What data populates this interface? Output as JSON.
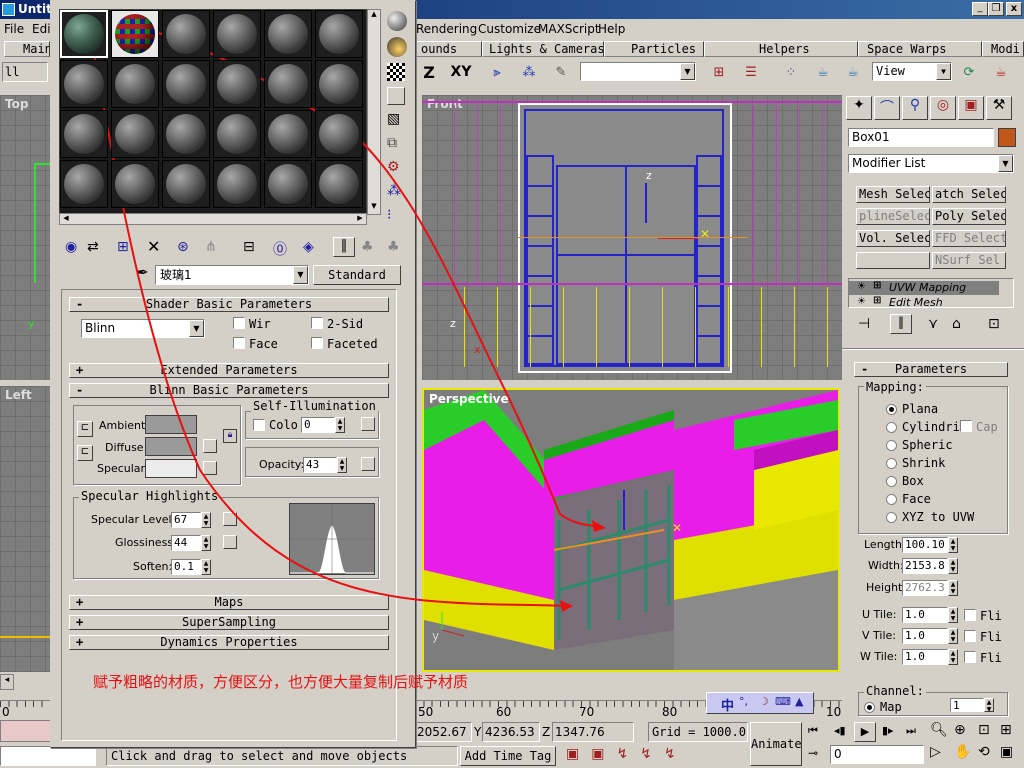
{
  "app": {
    "title": "Untit",
    "window_controls": {
      "minimize": "_",
      "restore": "❐",
      "close": "x"
    }
  },
  "menu": {
    "items": [
      "File",
      "Edit",
      "Rendering",
      "Customize",
      "MAXScript",
      "Help"
    ]
  },
  "tabs": [
    "Main",
    "ounds",
    "Lights & Cameras",
    "Particles",
    "Helpers",
    "Space Warps",
    "Modi"
  ],
  "toolbar": {
    "selection_field": "ll",
    "axis_z": "Z",
    "axis_xy": "XY",
    "view_dropdown": "View"
  },
  "viewports": {
    "top": {
      "label": "Top"
    },
    "left": {
      "label": "Left"
    },
    "front": {
      "label": "Front"
    },
    "perspective": {
      "label": "Perspective"
    },
    "axis_x": "x",
    "axis_y": "y",
    "axis_z": "z"
  },
  "material_editor": {
    "material_name": "玻璃1",
    "material_type": "Standard",
    "rollouts": {
      "shader_basic": "Shader Basic Parameters",
      "extended": "Extended Parameters",
      "blinn_basic": "Blinn Basic Parameters",
      "maps": "Maps",
      "supersampling": "SuperSampling",
      "dynamics": "Dynamics Properties"
    },
    "shader": {
      "type": "Blinn",
      "wire": "Wir",
      "two_sided": "2-Sid",
      "face_map": "Face",
      "faceted": "Faceted"
    },
    "blinn": {
      "ambient_label": "Ambient:",
      "diffuse_label": "Diffuse:",
      "specular_label": "Specular:",
      "self_illum_title": "Self-Illumination",
      "color_label": "Colo",
      "color_value": "0",
      "opacity_label": "Opacity:",
      "opacity_value": "43",
      "lock_icon": "lock",
      "ambient_color": "#9a9a9a",
      "diffuse_color": "#9a9a9a",
      "specular_color": "#ebebeb"
    },
    "specular": {
      "title": "Specular Highlights",
      "level_label": "Specular Level:",
      "level_value": "67",
      "gloss_label": "Glossiness:",
      "gloss_value": "44",
      "soften_label": "Soften:",
      "soften_value": "0.1"
    },
    "sample_slots": [
      {
        "kind": "glass-sphere"
      },
      {
        "kind": "checker-sphere"
      },
      {
        "kind": "gray-sphere"
      },
      {
        "kind": "gray-sphere"
      },
      {
        "kind": "gray-sphere"
      },
      {
        "kind": "gray-sphere"
      },
      {
        "kind": "gray-sphere"
      },
      {
        "kind": "gray-sphere"
      },
      {
        "kind": "gray-sphere"
      },
      {
        "kind": "gray-sphere"
      },
      {
        "kind": "gray-sphere"
      },
      {
        "kind": "gray-sphere"
      },
      {
        "kind": "gray-sphere"
      },
      {
        "kind": "gray-sphere"
      },
      {
        "kind": "gray-sphere"
      },
      {
        "kind": "gray-sphere"
      },
      {
        "kind": "gray-sphere"
      },
      {
        "kind": "gray-sphere"
      },
      {
        "kind": "gray-sphere"
      },
      {
        "kind": "gray-sphere"
      },
      {
        "kind": "gray-sphere"
      },
      {
        "kind": "gray-sphere"
      },
      {
        "kind": "gray-sphere"
      },
      {
        "kind": "gray-sphere"
      }
    ]
  },
  "annotation": {
    "caption": "赋予粗略的材质，方便区分，也方便大量复制后赋予材质",
    "color": "#e81010"
  },
  "command_panel": {
    "object_name": "Box01",
    "object_color": "#c0581c",
    "modifier_list": "Modifier List",
    "modifier_buttons": [
      "Mesh Select",
      "atch Selec",
      "plineSelec",
      "Poly Selec",
      "Vol. Selec",
      "FFD Select",
      "",
      "NSurf Sel"
    ],
    "stack": [
      "UVW Mapping",
      "Edit Mesh"
    ],
    "params_title": "Parameters",
    "mapping_label": "Mapping:",
    "mapping_options": [
      "Plana",
      "Cylindri",
      "Spheric",
      "Shrink",
      "Box",
      "Face",
      "XYZ to UVW"
    ],
    "mapping_selected": 0,
    "cap_label": "Cap",
    "length_label": "Length:",
    "length_value": "100.10",
    "width_label": "Width:",
    "width_value": "2153.8",
    "height_label": "Height:",
    "height_value": "2762.3",
    "u_tile_label": "U Tile:",
    "u_tile_value": "1.0",
    "v_tile_label": "V Tile:",
    "v_tile_value": "1.0",
    "w_tile_label": "W Tile:",
    "w_tile_value": "1.0",
    "flip_label": "Fli",
    "channel_label": "Channel:",
    "map_label": "Map",
    "channel_value": "1"
  },
  "status": {
    "ruler_ticks": [
      "0",
      "50",
      "60",
      "70",
      "80",
      "10"
    ],
    "x_value": "2052.67",
    "y_label": "Y",
    "y_value": "4236.53",
    "z_label": "Z",
    "z_value": "1347.76",
    "grid": "Grid = 1000.0",
    "prompt": "Click and drag to select and move objects",
    "add_time_tag": "Add Time Tag",
    "animate": "Animate",
    "frame": "0",
    "ime": "中"
  }
}
